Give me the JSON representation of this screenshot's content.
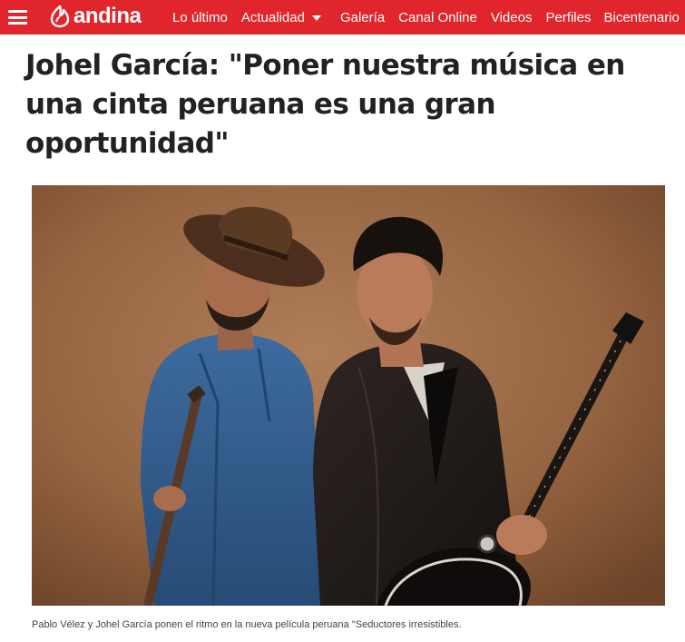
{
  "header": {
    "logo_text": "andina",
    "nav": [
      {
        "label": "Lo último"
      },
      {
        "label": "Actualidad",
        "has_dropdown": true
      },
      {
        "label": "Galería"
      },
      {
        "label": "Canal Online"
      },
      {
        "label": "Videos"
      },
      {
        "label": "Perfiles"
      },
      {
        "label": "Bicentenario"
      }
    ]
  },
  "article": {
    "title": "Johel García: \"Poner nuestra música en una cinta peruana es una gran oportunidad\"",
    "image_caption": "Pablo Vélez y Johel García ponen el ritmo en la nueva película peruana \"Seductores irresistibles."
  },
  "colors": {
    "brand_red": "#e0262c",
    "headline": "#222222",
    "photo_background": "#9a6a45"
  },
  "icons": {
    "menu": "hamburger-menu-icon",
    "logo": "andina-flame-logo-icon",
    "dropdown": "caret-down-icon"
  }
}
